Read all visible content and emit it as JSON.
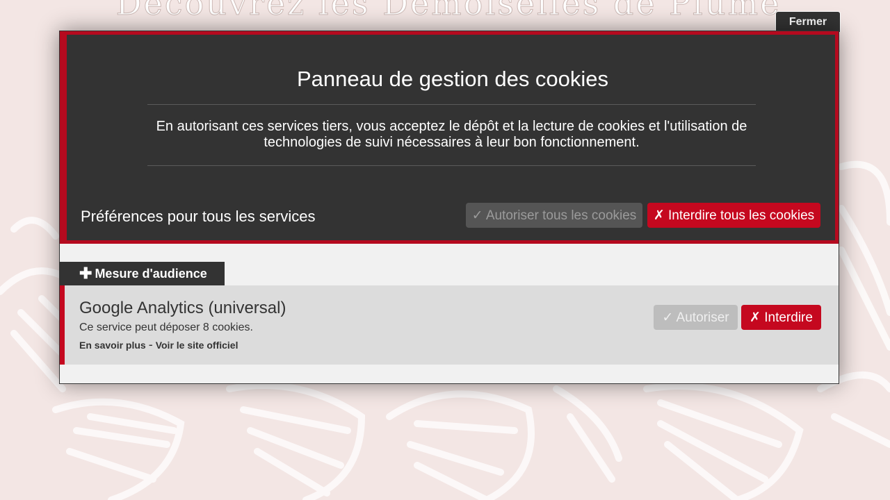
{
  "background": {
    "title": "Découvrez les Demoiselles de Plume"
  },
  "close_button": {
    "label": "Fermer"
  },
  "panel": {
    "title": "Panneau de gestion des cookies",
    "description": "En autorisant ces services tiers, vous acceptez le dépôt et la lecture de cookies et l'utilisation de technologies de suivi nécessaires à leur bon fonctionnement.",
    "preferences_label": "Préférences pour tous les services",
    "allow_all_label": "✓ Autoriser tous les cookies",
    "deny_all_label": "✗ Interdire tous les cookies"
  },
  "category": {
    "icon": "plus-icon",
    "plus": "✚",
    "label": "Mesure d'audience"
  },
  "service": {
    "name": "Google Analytics (universal)",
    "description": "Ce service peut déposer 8 cookies.",
    "learn_more": "En savoir plus",
    "separator": "-",
    "official_site": "Voir le site officiel",
    "allow_label": "✓ Autoriser",
    "deny_label": "✗ Interdire"
  },
  "colors": {
    "accent": "#c5081f",
    "panel_dark": "#333333",
    "panel_light": "#f1f1f1"
  }
}
